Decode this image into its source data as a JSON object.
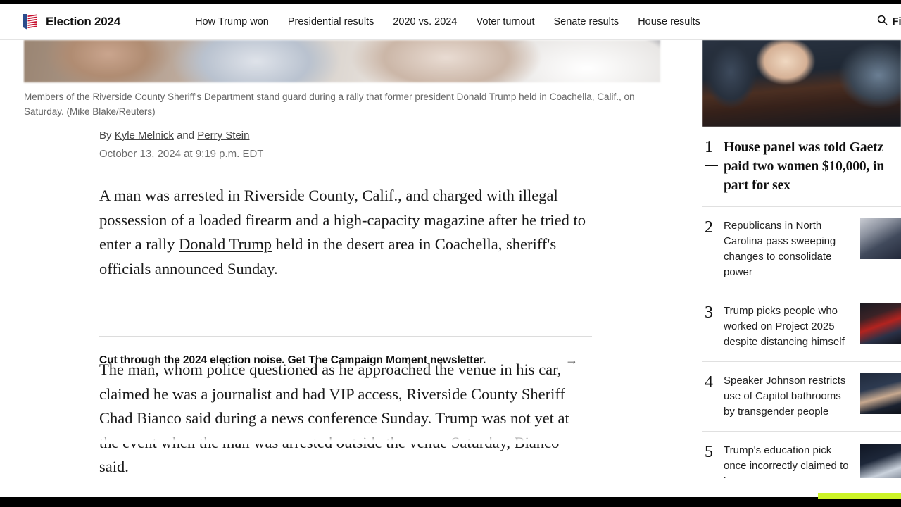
{
  "header": {
    "brand_title": "Election 2024",
    "logo_icon": "ballot-flag-icon",
    "nav_items": [
      {
        "label": "How Trump won"
      },
      {
        "label": "Presidential results"
      },
      {
        "label": "2020 vs. 2024"
      },
      {
        "label": "Voter turnout"
      },
      {
        "label": "Senate results"
      },
      {
        "label": "House results"
      }
    ],
    "search_icon": "search-icon",
    "search_label": "Find re"
  },
  "article": {
    "photo_caption": "Members of the Riverside County Sheriff's Department stand guard during a rally that former president Donald Trump held in Coachella, Calif., on Saturday. (Mike Blake/Reuters)",
    "byline_prefix": "By ",
    "author_one": "Kyle Melnick",
    "byline_conjunction": " and ",
    "author_two": "Perry Stein",
    "timestamp": "October 13, 2024 at 9:19 p.m. EDT",
    "paragraph_one_part_one": "A man was arrested in Riverside County, Calif., and charged with illegal possession of a loaded firearm and a high-capacity magazine after he tried to enter a rally ",
    "paragraph_one_link": "Donald Trump",
    "paragraph_one_part_two": " held in the desert area in Coachella, sheriff's officials announced Sunday.",
    "paragraph_two": "The man, whom police questioned as he approached the venue in his car, claimed he was a journalist and had VIP access, Riverside County Sheriff Chad Bianco said during a news conference Sunday. Trump was not yet at the event when the man was arrested outside the venue Saturday, Bianco said."
  },
  "newsletter_promo": {
    "text": "Cut through the 2024 election noise. Get The Campaign Moment newsletter.",
    "arrow_icon": "arrow-right-icon"
  },
  "right_rail": {
    "lead_photo_alt": "congressional-hearing-photo",
    "items": [
      {
        "rank": "1",
        "headline": "House panel was told Gaetz paid two women $10,000, in part for sex",
        "thumb": ""
      },
      {
        "rank": "2",
        "headline": "Republicans in North Carolina pass sweeping changes to consolidate power",
        "thumb": "t2"
      },
      {
        "rank": "3",
        "headline": "Trump picks people who worked on Project 2025 despite distancing himself",
        "thumb": "t3"
      },
      {
        "rank": "4",
        "headline": "Speaker Johnson restricts use of Capitol bathrooms by transgender people",
        "thumb": "t4"
      },
      {
        "rank": "5",
        "headline": "Trump's education pick once incorrectly claimed to have",
        "thumb": "t5"
      }
    ]
  },
  "colors": {
    "accent_bar": "#cdf428",
    "logo_blue": "#2b4c8c",
    "logo_red": "#c8102e",
    "text_primary": "#111111",
    "text_muted": "#666666"
  }
}
